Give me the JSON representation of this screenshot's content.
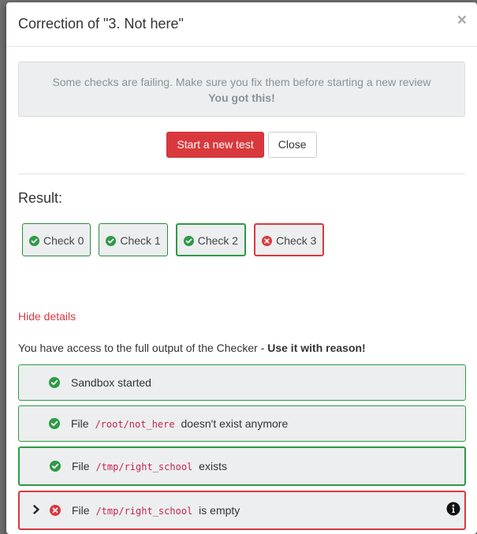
{
  "modal": {
    "title": "Correction of \"3. Not here\"",
    "close_symbol": "×",
    "alert": {
      "line1": "Some checks are failing. Make sure you fix them before starting a new review",
      "line2": "You got this!"
    },
    "buttons": {
      "start_new_test": "Start a new test",
      "close": "Close"
    },
    "result_label": "Result:",
    "checks": [
      {
        "label": "Check 0",
        "status": "pass",
        "icon": "check-circle-icon"
      },
      {
        "label": "Check 1",
        "status": "pass",
        "icon": "check-circle-icon"
      },
      {
        "label": "Check 2",
        "status": "pass",
        "icon": "check-circle-icon"
      },
      {
        "label": "Check 3",
        "status": "fail",
        "icon": "x-circle-icon"
      }
    ],
    "hide_details": "Hide details",
    "access_note": {
      "text": "You have access to the full output of the Checker - ",
      "emphasis": "Use it with reason!"
    },
    "output": [
      {
        "status": "pass",
        "prefix": "Sandbox started",
        "code": "",
        "suffix": ""
      },
      {
        "status": "pass",
        "prefix": "File",
        "code": "/root/not_here",
        "suffix": "doesn't exist anymore"
      },
      {
        "status": "pass",
        "prefix": "File",
        "code": "/tmp/right_school",
        "suffix": "exists"
      },
      {
        "status": "fail",
        "prefix": "File",
        "code": "/tmp/right_school",
        "suffix": "is empty"
      }
    ]
  },
  "colors": {
    "success": "#2e9a45",
    "danger": "#d9393d",
    "code": "#c7254e",
    "panel_bg": "#eceeef"
  }
}
